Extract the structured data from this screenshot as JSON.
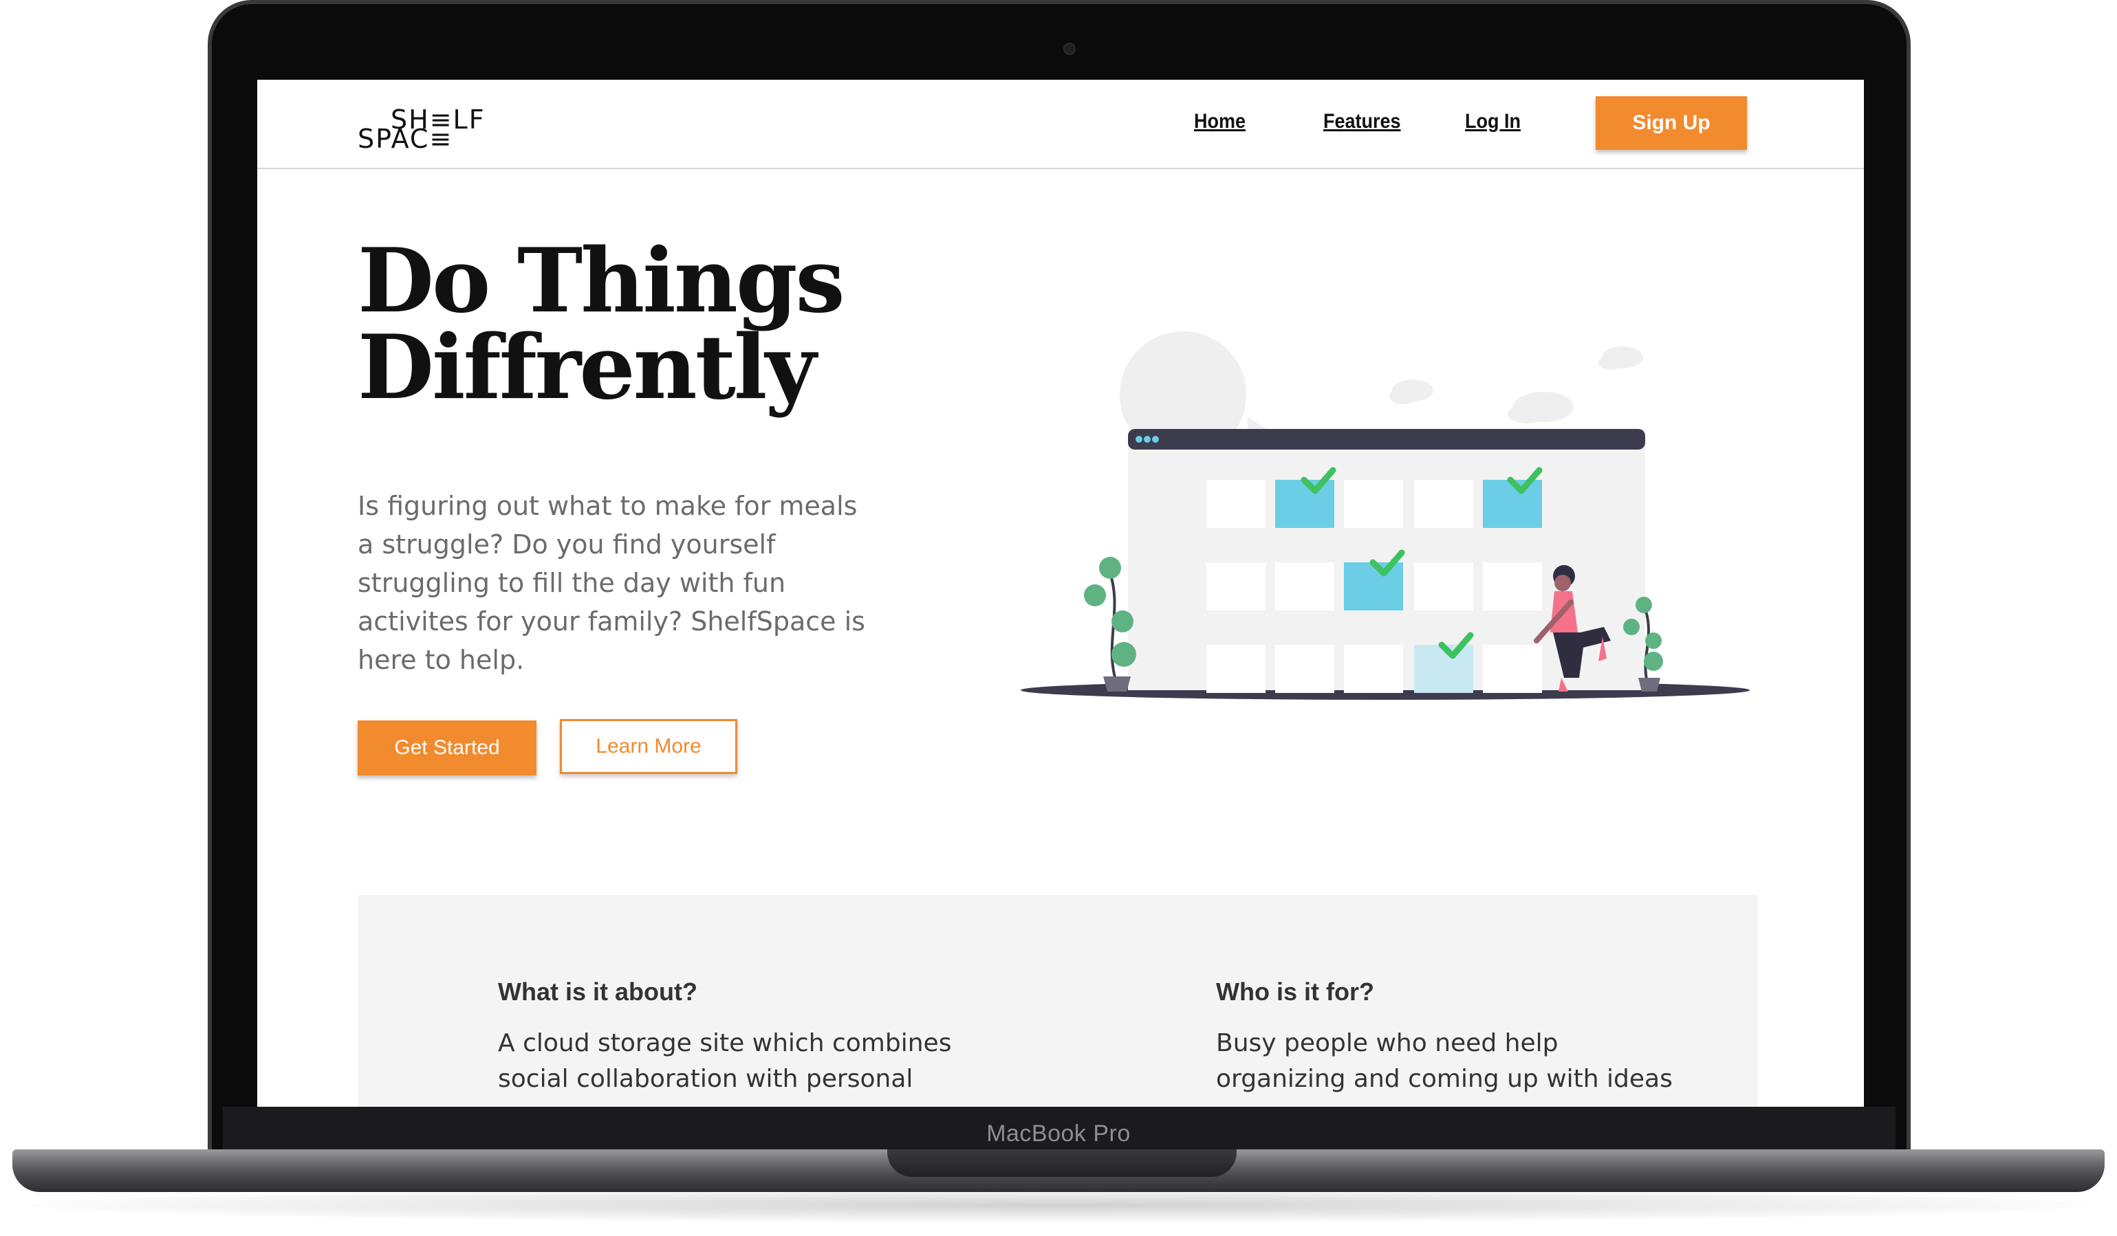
{
  "device": {
    "label": "MacBook Pro"
  },
  "brand": {
    "logo_top": "SH≡LF",
    "logo_bottom": "SPAC≡"
  },
  "nav": {
    "links": [
      "Home",
      "Features",
      "Log In"
    ],
    "signup_label": "Sign Up"
  },
  "hero": {
    "title_line1": "Do Things",
    "title_line2": "Diffrently",
    "description": "Is figuring out what to make for meals a struggle? Do you find yourself struggling to fill the day with fun activites for your family? ShelfSpace is here to help.",
    "primary_button": "Get Started",
    "secondary_button": "Learn More"
  },
  "info": {
    "about_heading": "What is it about?",
    "about_text": "A cloud storage site which combines social collaboration with personal",
    "audience_heading": "Who is it for?",
    "audience_text": "Busy people who need help organizing and coming up with ideas"
  },
  "colors": {
    "accent": "#f28a2e",
    "calendar_done": "#6ccde6",
    "check": "#3ec25f",
    "person_top": "#f4728a"
  }
}
